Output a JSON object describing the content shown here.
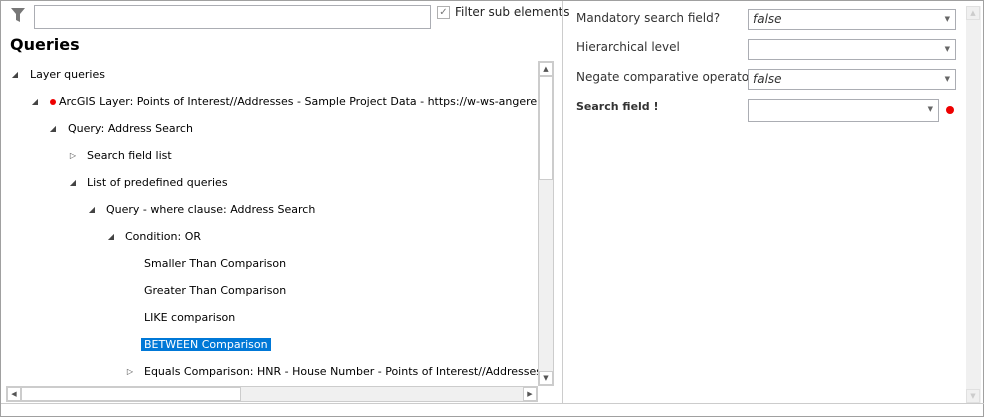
{
  "filter": {
    "value": "",
    "checkbox_label": "Filter sub elements",
    "checked": true
  },
  "panel_title": "Queries",
  "tree": [
    {
      "label": "Layer queries",
      "toggle": "expanded"
    },
    {
      "label": "ArcGIS Layer: Points of Interest//Addresses - Sample Project Data - https://w-ws-angerer.syner",
      "toggle": "expanded",
      "error": true
    },
    {
      "label": "Query: Address Search",
      "toggle": "expanded"
    },
    {
      "label": "Search field list",
      "toggle": "collapsed"
    },
    {
      "label": "List of predefined queries",
      "toggle": "expanded"
    },
    {
      "label": "Query - where clause: Address Search",
      "toggle": "expanded"
    },
    {
      "label": "Condition: OR",
      "toggle": "expanded"
    },
    {
      "label": "Smaller Than Comparison"
    },
    {
      "label": "Greater Than Comparison"
    },
    {
      "label": "LIKE comparison"
    },
    {
      "label": "BETWEEN Comparison",
      "selected": true
    },
    {
      "label": "Equals Comparison: HNR - House Number - Points of Interest//Addresses - Sa",
      "toggle": "collapsed"
    }
  ],
  "properties": [
    {
      "label": "Mandatory search field?",
      "value": "false"
    },
    {
      "label": "Hierarchical level",
      "value": ""
    },
    {
      "label": "Negate comparative operator?",
      "value": "false"
    },
    {
      "label": "Search field !",
      "value": "",
      "bold": true,
      "error": true
    }
  ],
  "colors": {
    "selection": "#0078d7",
    "error": "#e00000"
  }
}
